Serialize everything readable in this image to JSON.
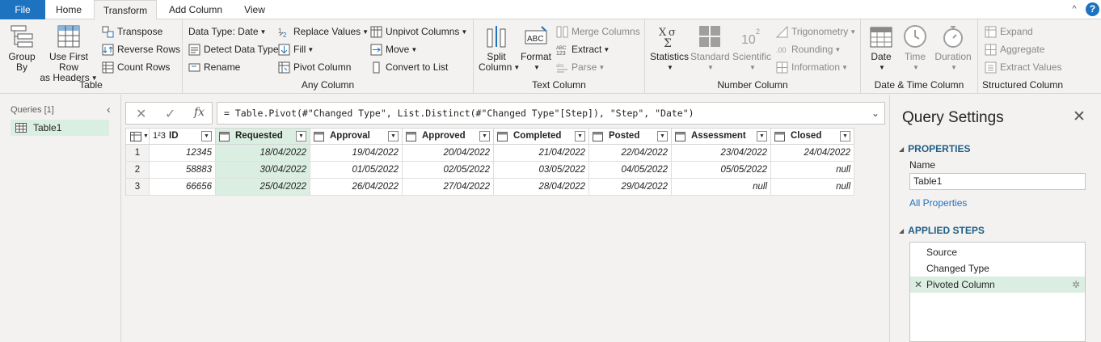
{
  "tabs": [
    "File",
    "Home",
    "Transform",
    "Add Column",
    "View"
  ],
  "window": {
    "collapse_glyph": "^",
    "help_glyph": "?"
  },
  "ribbon": {
    "table": {
      "label": "Table",
      "group_by": [
        "Group",
        "By"
      ],
      "first_row": [
        "Use First Row",
        "as Headers"
      ],
      "transpose": "Transpose",
      "reverse_rows": "Reverse Rows",
      "count_rows": "Count Rows"
    },
    "any_column": {
      "label": "Any Column",
      "data_type": "Data Type: Date",
      "detect": "Detect Data Type",
      "rename": "Rename",
      "replace": "Replace Values",
      "fill": "Fill",
      "pivot": "Pivot Column",
      "unpivot": "Unpivot Columns",
      "move": "Move",
      "convert": "Convert to List"
    },
    "text_column": {
      "label": "Text Column",
      "split": [
        "Split",
        "Column"
      ],
      "format": "Format",
      "merge": "Merge Columns",
      "extract": "Extract",
      "parse": "Parse"
    },
    "number_column": {
      "label": "Number Column",
      "statistics": "Statistics",
      "standard": "Standard",
      "scientific": "Scientific",
      "trig": "Trigonometry",
      "rounding": "Rounding",
      "information": "Information"
    },
    "datetime_column": {
      "label": "Date & Time Column",
      "date": "Date",
      "time": "Time",
      "duration": "Duration"
    },
    "structured": {
      "label": "Structured Column",
      "expand": "Expand",
      "aggregate": "Aggregate",
      "extract_values": "Extract Values"
    }
  },
  "queries": {
    "title": "Queries [1]",
    "items": [
      "Table1"
    ]
  },
  "formula": {
    "text": "= Table.Pivot(#\"Changed Type\", List.Distinct(#\"Changed Type\"[Step]), \"Step\", \"Date\")",
    "cancel_glyph": "✕",
    "commit_glyph": "✓",
    "fx_glyph": "fx",
    "expand_glyph": "⌄"
  },
  "grid": {
    "headers": [
      "ID",
      "Requested",
      "Approval",
      "Approved",
      "Completed",
      "Posted",
      "Assessment",
      "Closed"
    ],
    "type_badge_id": "1²3",
    "rows": [
      [
        "12345",
        "18/04/2022",
        "19/04/2022",
        "20/04/2022",
        "21/04/2022",
        "22/04/2022",
        "23/04/2022",
        "24/04/2022"
      ],
      [
        "58883",
        "30/04/2022",
        "01/05/2022",
        "02/05/2022",
        "03/05/2022",
        "04/05/2022",
        "05/05/2022",
        "null"
      ],
      [
        "66656",
        "25/04/2022",
        "26/04/2022",
        "27/04/2022",
        "28/04/2022",
        "29/04/2022",
        "null",
        "null"
      ]
    ],
    "row_numbers": [
      "1",
      "2",
      "3"
    ]
  },
  "settings": {
    "title": "Query Settings",
    "close_glyph": "✕",
    "properties": "PROPERTIES",
    "name_label": "Name",
    "name_value": "Table1",
    "all_properties": "All Properties",
    "applied_steps": "APPLIED STEPS",
    "steps": [
      "Source",
      "Changed Type",
      "Pivoted Column"
    ],
    "step_delete_glyph": "✕",
    "step_gear_glyph": "✲"
  },
  "colors": {
    "accent": "#1e73c0",
    "selected": "#dbeee2",
    "section": "#1e5f86"
  }
}
